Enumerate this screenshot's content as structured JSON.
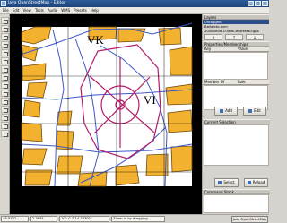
{
  "window": {
    "title": "Java OpenStreetMap - Editor",
    "minimize": "_",
    "maximize": "□",
    "close": "×"
  },
  "menu": [
    "File",
    "Edit",
    "View",
    "Tools",
    "Audio",
    "WMS",
    "Presets",
    "Help"
  ],
  "map": {
    "scale": "100 m",
    "label_left": "VK",
    "label_center": "VI",
    "colors": {
      "background": "#ffffff",
      "building": "#f2b12f",
      "building_edge": "#6e4a12",
      "roads": "#3d58c6",
      "selection": "#b21a6a",
      "grid": "#000000"
    }
  },
  "right_panel": {
    "layers_title": "Layers",
    "layers": [
      "Untagged",
      "Ballaleta.osm",
      "20080606-CulowCentreMall.gpx"
    ],
    "buttons_small": [
      "×",
      "↑",
      "↓"
    ],
    "properties_title": "Properties/Memberships",
    "key_header": "Key",
    "value_header": "Value",
    "member_header": "Member Of",
    "role_header": "Role",
    "add_label": "Add",
    "edit_label": "Edit",
    "current_selection_title": "Current Selection",
    "select_label": "Select",
    "reload_label": "Reload",
    "command_stack_title": "Command Stack"
  },
  "status": {
    "lat": "48.9702",
    "lon": "2.3681",
    "extra": "101.0 7(14.77301)",
    "zoom": "Zoom in by dragging",
    "taskbar": "Java OpenStreetMap"
  }
}
